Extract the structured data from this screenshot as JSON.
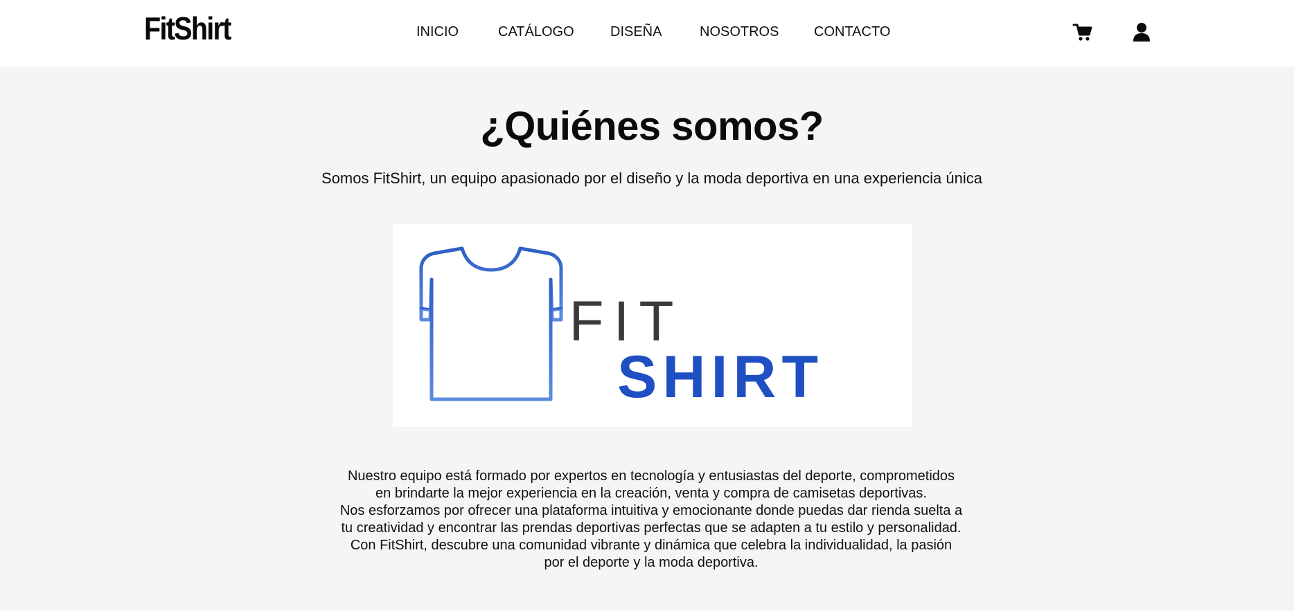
{
  "header": {
    "brand": "FitShirt",
    "nav": [
      {
        "label": "INICIO"
      },
      {
        "label": "CATÁLOGO"
      },
      {
        "label": "DISEÑA"
      },
      {
        "label": "NOSOTROS"
      },
      {
        "label": "CONTACTO"
      }
    ],
    "icons": {
      "cart": "shopping-cart-icon",
      "user": "user-icon"
    }
  },
  "main": {
    "title": "¿Quiénes somos?",
    "subtitle": "Somos FitShirt, un equipo apasionado por el diseño y la moda deportiva en una experiencia única",
    "logo": {
      "word_top": "FIT",
      "word_bottom": "SHIRT",
      "icon": "t-shirt-icon",
      "colors": {
        "shirt": "#3d6fcf",
        "fit": "#3a3a3a",
        "shirt_text": "#1f4fc2"
      }
    },
    "description": [
      "Nuestro equipo está formado por expertos en tecnología y entusiastas del deporte, comprometidos en brindarte la mejor experiencia en la creación, venta y compra de camisetas deportivas.",
      "Nos esforzamos por ofrecer una plataforma intuitiva y emocionante donde puedas dar rienda suelta a tu creatividad y encontrar las prendas deportivas perfectas que se adapten a tu estilo y personalidad. Con FitShirt, descubre una comunidad vibrante y dinámica que celebra la individualidad, la pasión por el deporte y la moda deportiva."
    ]
  }
}
